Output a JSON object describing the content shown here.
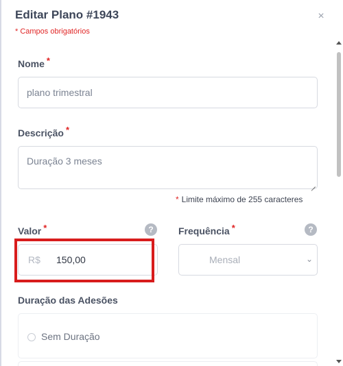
{
  "header": {
    "title": "Editar Plano #1943",
    "required_note": "* Campos obrigatórios",
    "close_symbol": "×"
  },
  "fields": {
    "nome": {
      "label": "Nome",
      "required": "*",
      "value": "plano trimestral"
    },
    "descricao": {
      "label": "Descrição",
      "required": "*",
      "value": "Duração 3 meses",
      "limit_star": "*",
      "limit_text": "Limite máximo de 255 caracteres"
    },
    "valor": {
      "label": "Valor",
      "required": "*",
      "prefix": "R$",
      "value": "150,00",
      "help": "?"
    },
    "frequencia": {
      "label": "Frequência",
      "required": "*",
      "selected": "Mensal",
      "help": "?"
    }
  },
  "duracao": {
    "label": "Duração das Adesões",
    "option": "Sem Duração"
  },
  "colors": {
    "accent_red": "#e02424",
    "highlight": "#d81c1c"
  },
  "icons": [
    "close-icon",
    "help-icon",
    "chevron-down-icon",
    "radio-icon"
  ]
}
